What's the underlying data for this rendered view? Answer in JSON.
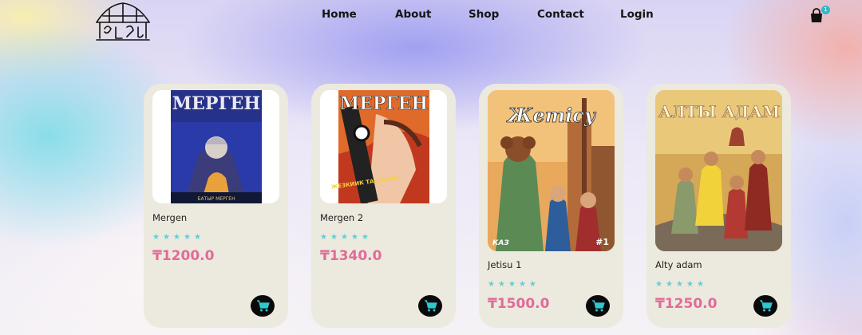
{
  "brand": {
    "logo_icon": "yurt-logo-icon"
  },
  "nav": {
    "items": [
      {
        "label": "Home"
      },
      {
        "label": "About"
      },
      {
        "label": "Shop"
      },
      {
        "label": "Contact"
      },
      {
        "label": "Login"
      }
    ]
  },
  "cart": {
    "icon": "shopping-bag-icon",
    "count": "1"
  },
  "products": [
    {
      "title": "Mergen",
      "rating": 5,
      "price": "₸1200.0",
      "cover_title": "МЕРГЕН",
      "cover_sub": "БАТЫР МЕРГЕН",
      "cart_icon": "cart-icon"
    },
    {
      "title": "Mergen 2",
      "rating": 5,
      "price": "₸1340.0",
      "cover_title": "МЕРГЕН",
      "cover_sub": "ЖЕЗКИИК ТАШАРАН",
      "cart_icon": "cart-icon"
    },
    {
      "title": "Jetisu 1",
      "rating": 5,
      "price": "₸1500.0",
      "cover_title": "Жетісу",
      "cover_sub": "КАЗ",
      "cover_badge": "#1",
      "cart_icon": "cart-icon"
    },
    {
      "title": "Alty adam",
      "rating": 5,
      "price": "₸1250.0",
      "cover_title": "АЛТЫ АДАМ",
      "cart_icon": "cart-icon"
    }
  ],
  "colors": {
    "accent_price": "#e36a98",
    "star": "#5fd0d5",
    "card_bg": "#ece9de",
    "badge": "#2fb9c9"
  }
}
